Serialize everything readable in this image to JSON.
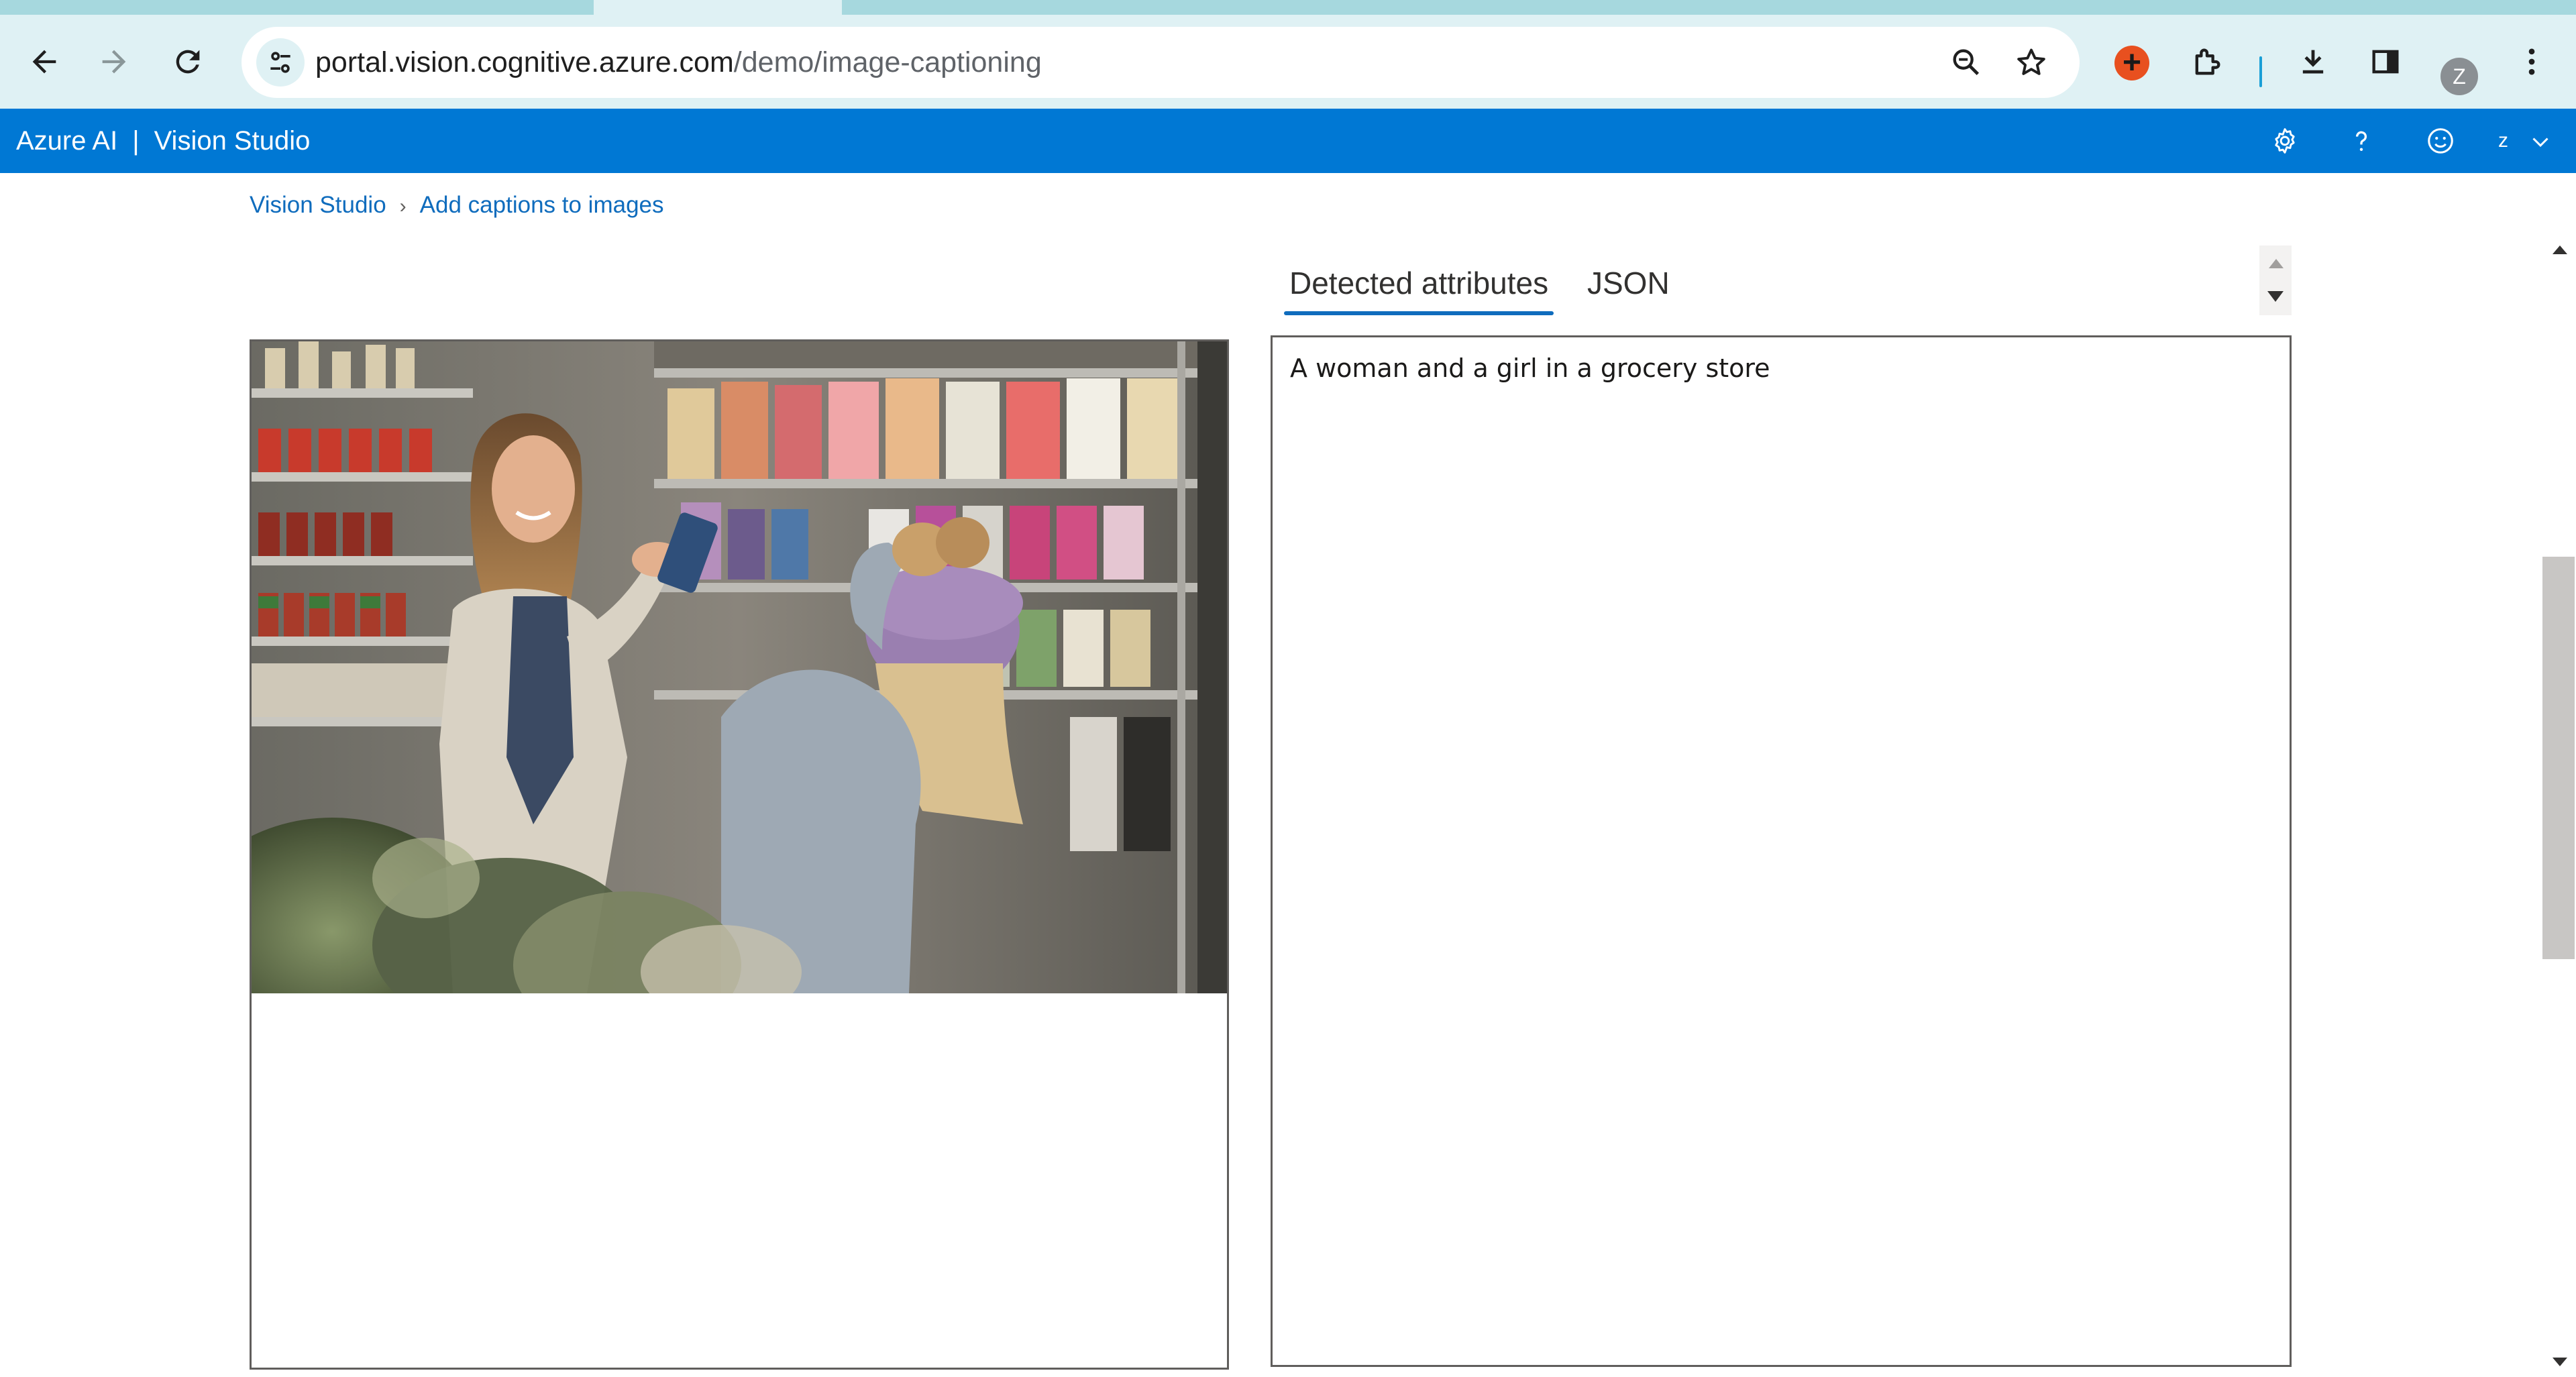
{
  "browser": {
    "url_host": "portal.vision.cognitive.azure.com",
    "url_path": "/demo/image-captioning",
    "profile_initial": "Z",
    "accent_colors": {
      "chrome_bg": "#dff1f4",
      "tabstrip": "#a6d8de",
      "extension": "#e8501f"
    }
  },
  "header": {
    "brand": "Azure AI",
    "separator": "|",
    "product": "Vision Studio",
    "user_initial": "z",
    "icons": [
      "settings-icon",
      "help-icon",
      "feedback-icon",
      "chevron-down-icon"
    ],
    "color": "#0078d4"
  },
  "breadcrumb": {
    "root": "Vision Studio",
    "current": "Add captions to images"
  },
  "tabs": [
    {
      "label": "Detected attributes",
      "selected": true
    },
    {
      "label": "JSON",
      "selected": false
    }
  ],
  "result": {
    "caption": "A woman and a girl in a grocery store"
  }
}
